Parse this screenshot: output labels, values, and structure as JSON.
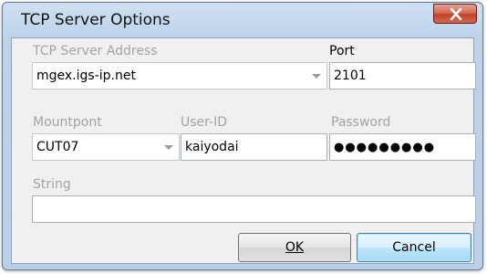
{
  "window": {
    "title": "TCP Server Options",
    "close_label": "X"
  },
  "form": {
    "server_address": {
      "label": "TCP Server Address",
      "value": "mgex.igs-ip.net"
    },
    "port": {
      "label": "Port",
      "value": "2101"
    },
    "mountpoint": {
      "label": "Mountpont",
      "value": "CUT07"
    },
    "user_id": {
      "label": "User-ID",
      "value": "kaiyodai"
    },
    "password": {
      "label": "Password",
      "value": "●●●●●●●●●"
    },
    "string": {
      "label": "String",
      "value": ""
    }
  },
  "buttons": {
    "ok_label": "OK",
    "cancel_label": "Cancel"
  },
  "colors": {
    "close_button": "#c2412b",
    "default_button_border": "#3c7fb1",
    "disabled_label": "#a3a3a3"
  }
}
